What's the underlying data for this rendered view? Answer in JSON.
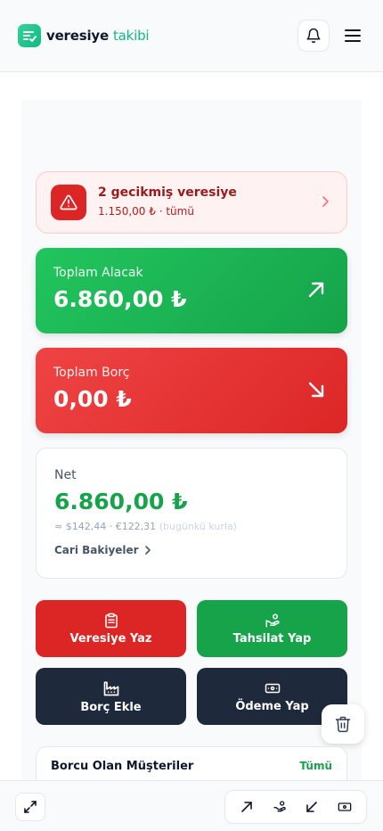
{
  "header": {
    "brand_primary": "veresiye",
    "brand_secondary": "takibi"
  },
  "alert": {
    "title": "2 gecikmiş veresiye",
    "subtitle": "1.150,00 ₺ · tümü"
  },
  "receivable": {
    "label": "Toplam Alacak",
    "value": "6.860,00 ₺"
  },
  "debt": {
    "label": "Toplam Borç",
    "value": "0,00 ₺"
  },
  "net": {
    "label": "Net",
    "value": "6.860,00 ₺",
    "fx": "≈ $142,44 · €122,31",
    "fx_note": "(bugünkü kurla)",
    "link_label": "Cari Bakiyeler"
  },
  "actions": [
    {
      "label": "Veresiye Yaz",
      "icon": "clipboard-list-icon"
    },
    {
      "label": "Tahsilat Yap",
      "icon": "hand-coins-icon"
    },
    {
      "label": "Borç Ekle",
      "icon": "factory-icon"
    },
    {
      "label": "Ödeme Yap",
      "icon": "banknote-icon"
    }
  ],
  "debtors": {
    "title": "Borcu Olan Müşteriler",
    "all_label": "Tümü"
  },
  "colors": {
    "brand": "#10b981",
    "success": "#16a34a",
    "danger": "#dc2626",
    "dark": "#1e293b"
  }
}
